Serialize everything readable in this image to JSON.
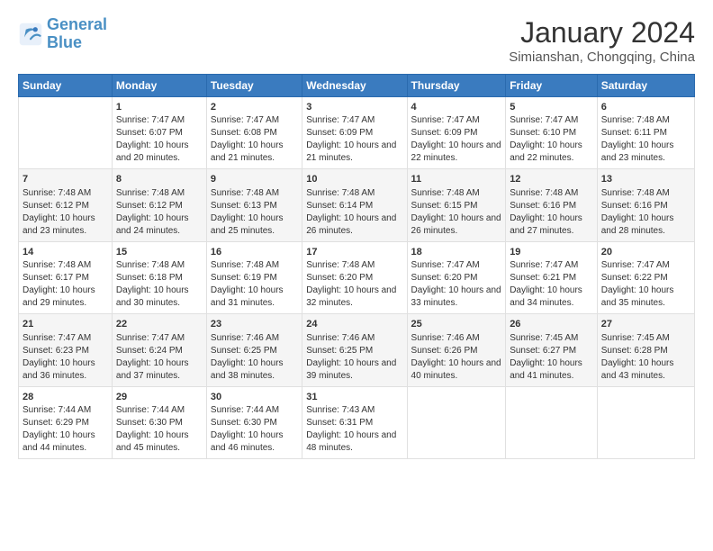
{
  "logo": {
    "line1": "General",
    "line2": "Blue"
  },
  "title": "January 2024",
  "subtitle": "Simianshan, Chongqing, China",
  "days_header": [
    "Sunday",
    "Monday",
    "Tuesday",
    "Wednesday",
    "Thursday",
    "Friday",
    "Saturday"
  ],
  "weeks": [
    [
      {
        "num": "",
        "text": ""
      },
      {
        "num": "1",
        "text": "Sunrise: 7:47 AM\nSunset: 6:07 PM\nDaylight: 10 hours and 20 minutes."
      },
      {
        "num": "2",
        "text": "Sunrise: 7:47 AM\nSunset: 6:08 PM\nDaylight: 10 hours and 21 minutes."
      },
      {
        "num": "3",
        "text": "Sunrise: 7:47 AM\nSunset: 6:09 PM\nDaylight: 10 hours and 21 minutes."
      },
      {
        "num": "4",
        "text": "Sunrise: 7:47 AM\nSunset: 6:09 PM\nDaylight: 10 hours and 22 minutes."
      },
      {
        "num": "5",
        "text": "Sunrise: 7:47 AM\nSunset: 6:10 PM\nDaylight: 10 hours and 22 minutes."
      },
      {
        "num": "6",
        "text": "Sunrise: 7:48 AM\nSunset: 6:11 PM\nDaylight: 10 hours and 23 minutes."
      }
    ],
    [
      {
        "num": "7",
        "text": "Sunrise: 7:48 AM\nSunset: 6:12 PM\nDaylight: 10 hours and 23 minutes."
      },
      {
        "num": "8",
        "text": "Sunrise: 7:48 AM\nSunset: 6:12 PM\nDaylight: 10 hours and 24 minutes."
      },
      {
        "num": "9",
        "text": "Sunrise: 7:48 AM\nSunset: 6:13 PM\nDaylight: 10 hours and 25 minutes."
      },
      {
        "num": "10",
        "text": "Sunrise: 7:48 AM\nSunset: 6:14 PM\nDaylight: 10 hours and 26 minutes."
      },
      {
        "num": "11",
        "text": "Sunrise: 7:48 AM\nSunset: 6:15 PM\nDaylight: 10 hours and 26 minutes."
      },
      {
        "num": "12",
        "text": "Sunrise: 7:48 AM\nSunset: 6:16 PM\nDaylight: 10 hours and 27 minutes."
      },
      {
        "num": "13",
        "text": "Sunrise: 7:48 AM\nSunset: 6:16 PM\nDaylight: 10 hours and 28 minutes."
      }
    ],
    [
      {
        "num": "14",
        "text": "Sunrise: 7:48 AM\nSunset: 6:17 PM\nDaylight: 10 hours and 29 minutes."
      },
      {
        "num": "15",
        "text": "Sunrise: 7:48 AM\nSunset: 6:18 PM\nDaylight: 10 hours and 30 minutes."
      },
      {
        "num": "16",
        "text": "Sunrise: 7:48 AM\nSunset: 6:19 PM\nDaylight: 10 hours and 31 minutes."
      },
      {
        "num": "17",
        "text": "Sunrise: 7:48 AM\nSunset: 6:20 PM\nDaylight: 10 hours and 32 minutes."
      },
      {
        "num": "18",
        "text": "Sunrise: 7:47 AM\nSunset: 6:20 PM\nDaylight: 10 hours and 33 minutes."
      },
      {
        "num": "19",
        "text": "Sunrise: 7:47 AM\nSunset: 6:21 PM\nDaylight: 10 hours and 34 minutes."
      },
      {
        "num": "20",
        "text": "Sunrise: 7:47 AM\nSunset: 6:22 PM\nDaylight: 10 hours and 35 minutes."
      }
    ],
    [
      {
        "num": "21",
        "text": "Sunrise: 7:47 AM\nSunset: 6:23 PM\nDaylight: 10 hours and 36 minutes."
      },
      {
        "num": "22",
        "text": "Sunrise: 7:47 AM\nSunset: 6:24 PM\nDaylight: 10 hours and 37 minutes."
      },
      {
        "num": "23",
        "text": "Sunrise: 7:46 AM\nSunset: 6:25 PM\nDaylight: 10 hours and 38 minutes."
      },
      {
        "num": "24",
        "text": "Sunrise: 7:46 AM\nSunset: 6:25 PM\nDaylight: 10 hours and 39 minutes."
      },
      {
        "num": "25",
        "text": "Sunrise: 7:46 AM\nSunset: 6:26 PM\nDaylight: 10 hours and 40 minutes."
      },
      {
        "num": "26",
        "text": "Sunrise: 7:45 AM\nSunset: 6:27 PM\nDaylight: 10 hours and 41 minutes."
      },
      {
        "num": "27",
        "text": "Sunrise: 7:45 AM\nSunset: 6:28 PM\nDaylight: 10 hours and 43 minutes."
      }
    ],
    [
      {
        "num": "28",
        "text": "Sunrise: 7:44 AM\nSunset: 6:29 PM\nDaylight: 10 hours and 44 minutes."
      },
      {
        "num": "29",
        "text": "Sunrise: 7:44 AM\nSunset: 6:30 PM\nDaylight: 10 hours and 45 minutes."
      },
      {
        "num": "30",
        "text": "Sunrise: 7:44 AM\nSunset: 6:30 PM\nDaylight: 10 hours and 46 minutes."
      },
      {
        "num": "31",
        "text": "Sunrise: 7:43 AM\nSunset: 6:31 PM\nDaylight: 10 hours and 48 minutes."
      },
      {
        "num": "",
        "text": ""
      },
      {
        "num": "",
        "text": ""
      },
      {
        "num": "",
        "text": ""
      }
    ]
  ]
}
